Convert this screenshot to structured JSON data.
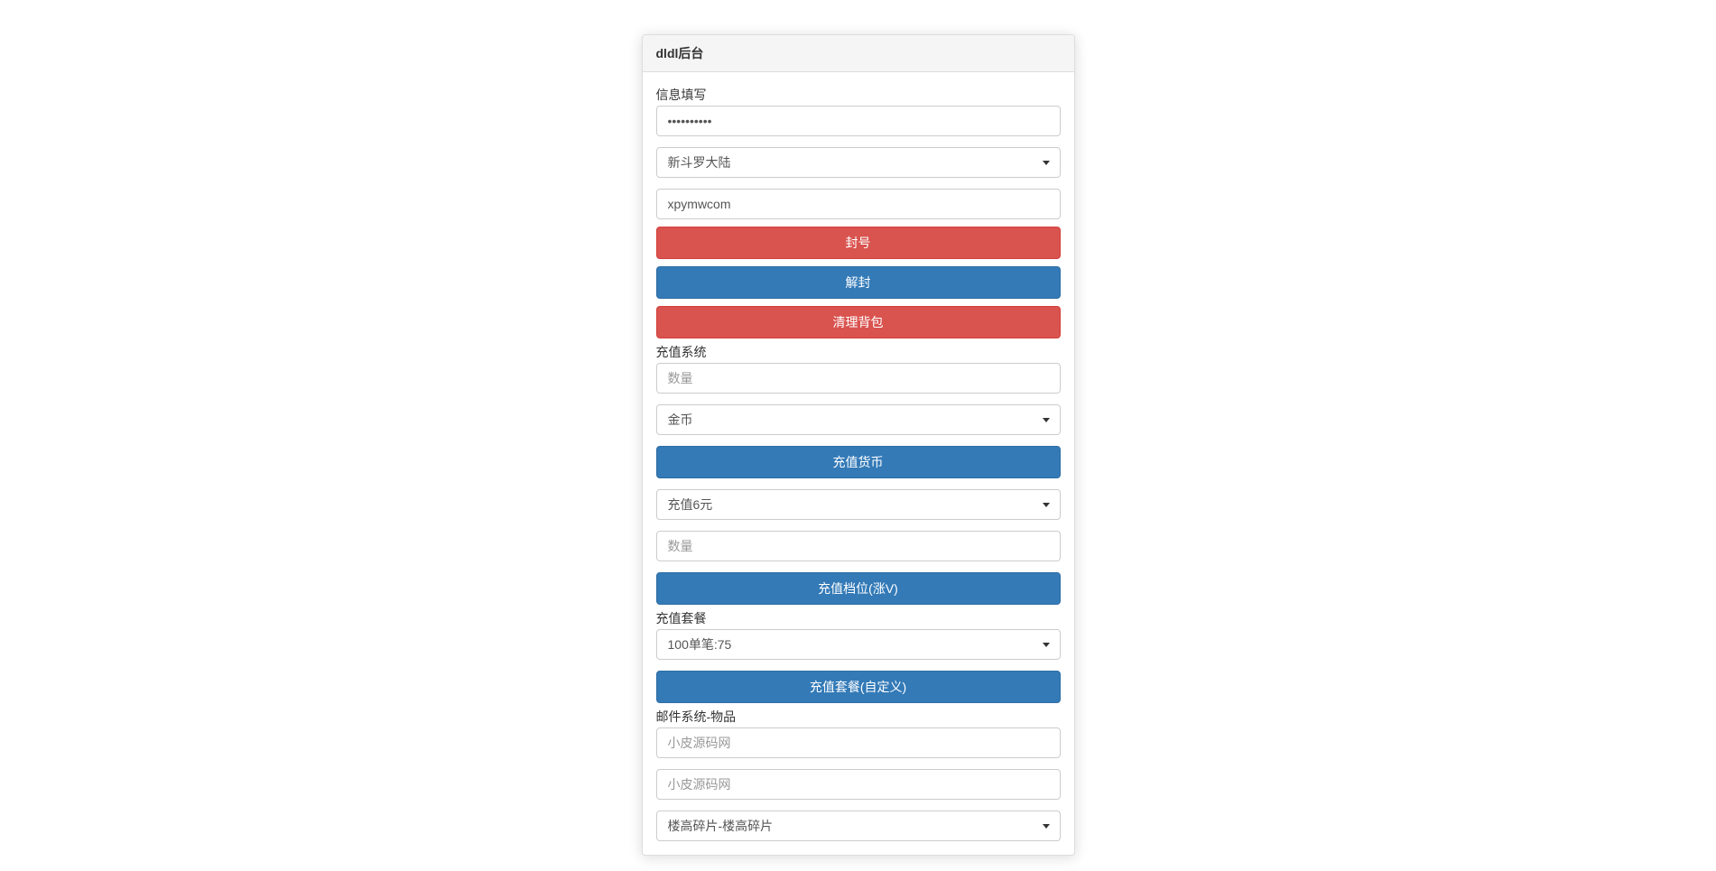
{
  "panel_title": "dldl后台",
  "info": {
    "section_label": "信息填写",
    "password_value": "••••••••••",
    "zone_selected": "新斗罗大陆",
    "username_value": "xpymwcom"
  },
  "actions": {
    "ban": "封号",
    "unban": "解封",
    "clear_bag": "清理背包"
  },
  "recharge": {
    "section_label": "充值系统",
    "qty_placeholder": "数量",
    "currency_selected": "金币",
    "recharge_currency_btn": "充值货币",
    "tier_selected": "充值6元",
    "tier_qty_placeholder": "数量",
    "recharge_tier_btn": "充值档位(涨V)"
  },
  "package": {
    "section_label": "充值套餐",
    "package_selected": "100单笔:75",
    "recharge_package_btn": "充值套餐(自定义)"
  },
  "mail": {
    "section_label": "邮件系统-物品",
    "field1_placeholder": "小皮源码网",
    "field2_placeholder": "小皮源码网",
    "item_selected": "楼高碎片-楼高碎片"
  }
}
